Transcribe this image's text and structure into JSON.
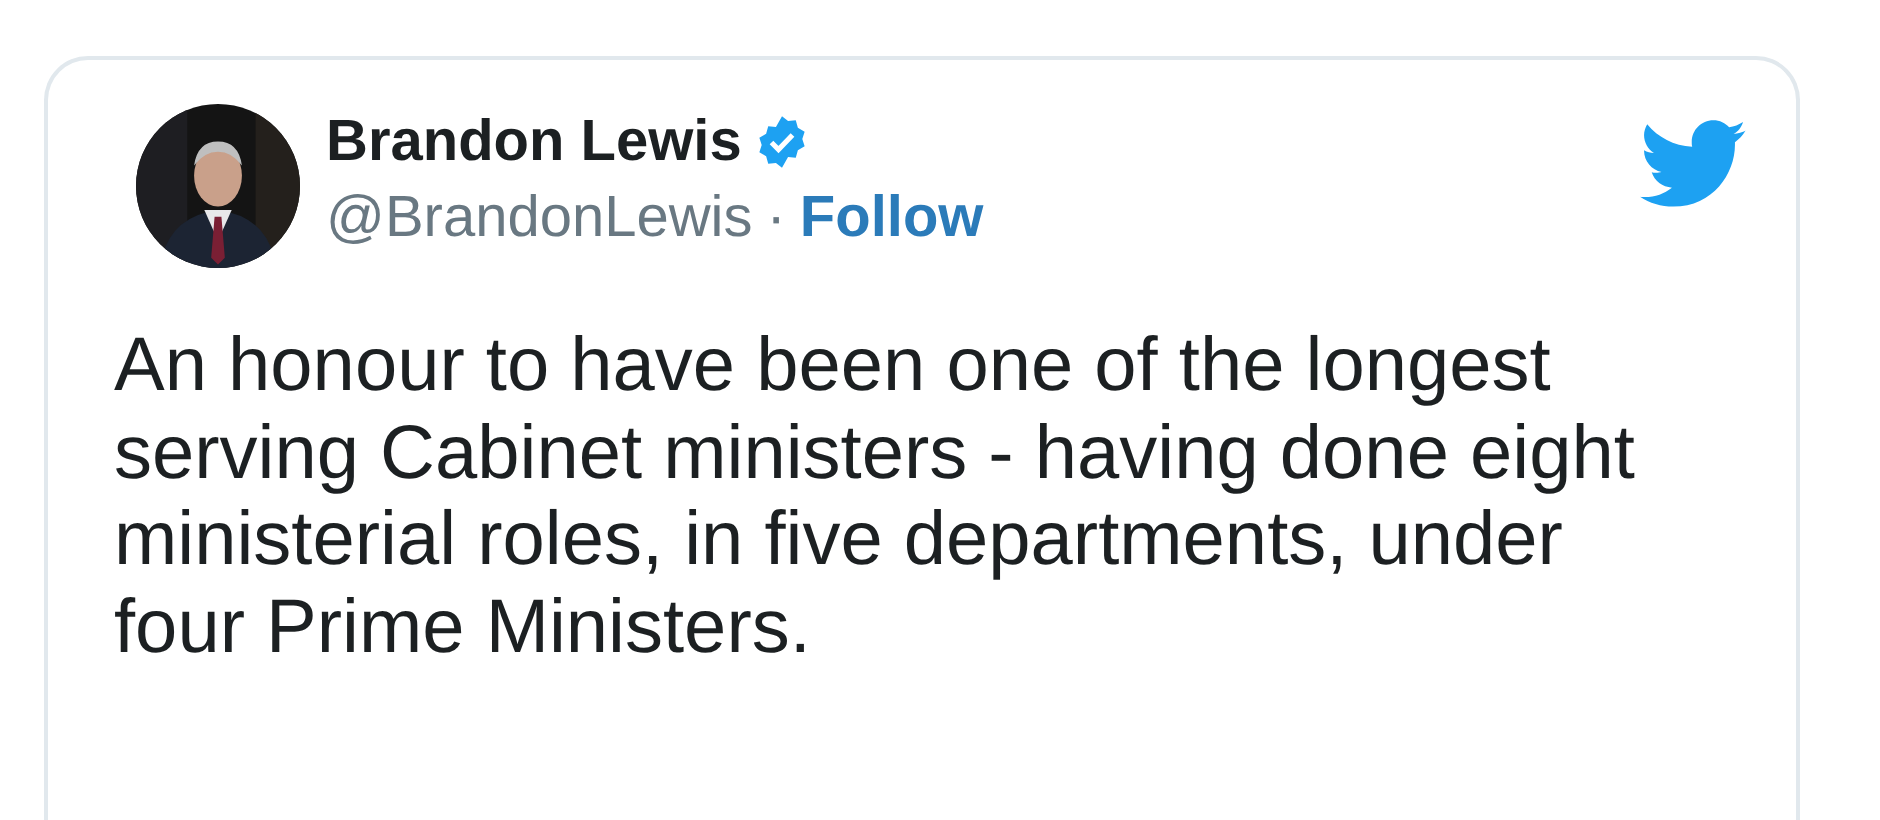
{
  "author": {
    "name": "Brandon Lewis",
    "verified": true,
    "handle": "@BrandonLewis",
    "separator": "·",
    "follow_label": "Follow"
  },
  "text": "An honour to have been one of the longest serving Cabinet ministers - having done eight ministerial roles, in five departments, under four Prime Ministers."
}
